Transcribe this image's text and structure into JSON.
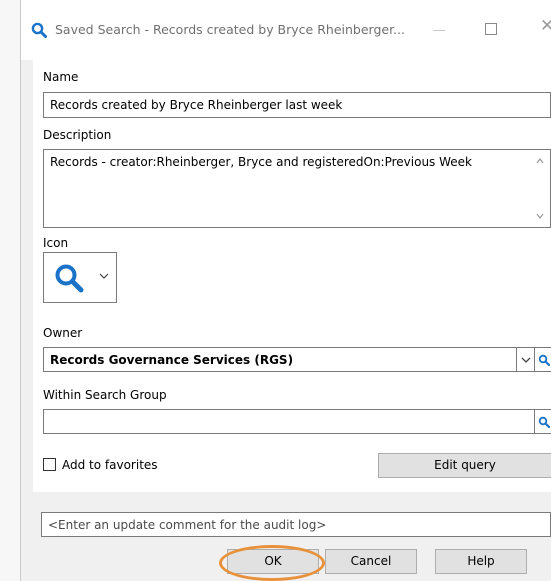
{
  "window": {
    "title": "Saved Search - Records created by Bryce Rheinberger...",
    "close_glyph": "✕"
  },
  "form": {
    "name_label": "Name",
    "name_value": "Records created by Bryce Rheinberger last week",
    "description_label": "Description",
    "description_value": "Records - creator:Rheinberger, Bryce and registeredOn:Previous Week",
    "icon_label": "Icon",
    "icon_selected": "search-icon",
    "owner_label": "Owner",
    "owner_value": "Records Governance Services (RGS)",
    "search_group_label": "Within Search Group",
    "search_group_value": "",
    "add_favorites_label": "Add to favorites",
    "add_favorites_checked": false,
    "edit_query_label": "Edit query"
  },
  "footer": {
    "comment_placeholder": "<Enter an update comment for the audit log>",
    "ok_label": "OK",
    "cancel_label": "Cancel",
    "help_label": "Help"
  },
  "colors": {
    "accent": "#1a73c8",
    "highlight": "#e8913a"
  }
}
